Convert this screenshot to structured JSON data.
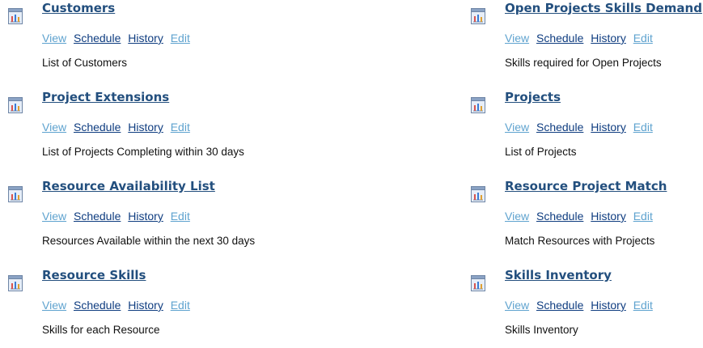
{
  "colors": {
    "title": "#234f7e",
    "link_light": "#5fa3cf",
    "link_dark": "#0f3d80",
    "text": "#111111"
  },
  "reports": [
    {
      "icon": "report-chart-icon",
      "title": "Customers",
      "actions": [
        "View",
        "Schedule",
        "History",
        "Edit"
      ],
      "description": "List of Customers"
    },
    {
      "icon": "report-chart-icon",
      "title": "Project Extensions",
      "actions": [
        "View",
        "Schedule",
        "History",
        "Edit"
      ],
      "description": "List of Projects Completing within 30 days"
    },
    {
      "icon": "report-chart-icon",
      "title": "Resource Availability List",
      "actions": [
        "View",
        "Schedule",
        "History",
        "Edit"
      ],
      "description": "Resources Available within the next 30 days"
    },
    {
      "icon": "report-chart-icon",
      "title": "Resource Skills",
      "actions": [
        "View",
        "Schedule",
        "History",
        "Edit"
      ],
      "description": "Skills for each Resource"
    },
    {
      "icon": "report-chart-icon",
      "title": "Open Projects Skills Demand",
      "actions": [
        "View",
        "Schedule",
        "History",
        "Edit"
      ],
      "description": "Skills required for Open Projects"
    },
    {
      "icon": "report-chart-icon",
      "title": "Projects",
      "actions": [
        "View",
        "Schedule",
        "History",
        "Edit"
      ],
      "description": "List of Projects"
    },
    {
      "icon": "report-chart-icon",
      "title": "Resource Project Match",
      "actions": [
        "View",
        "Schedule",
        "History",
        "Edit"
      ],
      "description": "Match Resources with Projects"
    },
    {
      "icon": "report-chart-icon",
      "title": "Skills Inventory",
      "actions": [
        "View",
        "Schedule",
        "History",
        "Edit"
      ],
      "description": "Skills Inventory"
    }
  ]
}
